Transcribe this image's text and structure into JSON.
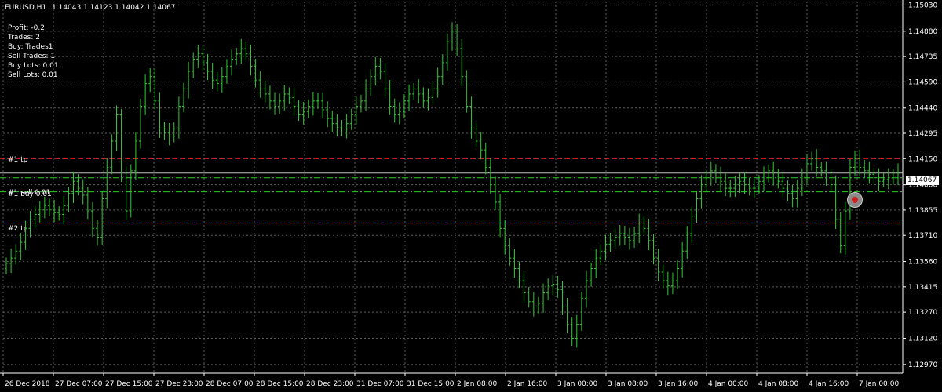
{
  "chart_header": {
    "symbol_timeframe": "EURUSD,H1",
    "ohlc": "1.14043 1.14123 1.14042 1.14067"
  },
  "stats": [
    "Profit: -0.2",
    "Trades: 2",
    "Buy: Trades1",
    "Sell Trades: 1",
    "Buy Lots: 0.01",
    "Sell Lots: 0.01"
  ],
  "colors": {
    "background": "#000000",
    "grid": "#5a5a5a",
    "bars": "#33cc33",
    "tp_line": "#ff2020",
    "entry_line": "#33cc33",
    "bid_line": "#c0c0c0",
    "axis_text": "#ffffff"
  },
  "order_lines": [
    {
      "label": "#1 tp",
      "price": 1.1415,
      "style": "dashed",
      "color": "#ff2020"
    },
    {
      "label": "#1 sell 0.01",
      "price": 1.1404,
      "style": "dash-dot",
      "color": "#33cc33"
    },
    {
      "label": "#1 buy 0.01",
      "price": 1.1396,
      "style": "dash-dot",
      "color": "#33cc33"
    },
    {
      "label": "#2 tp",
      "price": 1.1378,
      "style": "dashed",
      "color": "#ff2020"
    }
  ],
  "current_price": {
    "label": "1.14067",
    "value": 1.14067
  },
  "trade_marker_icon": "trade-arrow-icon",
  "chart_data": {
    "type": "ohlc-bar",
    "title": "EURUSD,H1",
    "ylim": [
      1.1292,
      1.1505
    ],
    "y_ticks": [
      "1.15030",
      "1.14880",
      "1.14735",
      "1.14590",
      "1.14440",
      "1.14295",
      "1.14150",
      "1.14000",
      "1.13855",
      "1.13710",
      "1.13560",
      "1.13415",
      "1.13270",
      "1.13120",
      "1.12970"
    ],
    "x_ticks": [
      "26 Dec 2018",
      "27 Dec 07:00",
      "27 Dec 15:00",
      "27 Dec 23:00",
      "28 Dec 07:00",
      "28 Dec 15:00",
      "28 Dec 23:00",
      "31 Dec 07:00",
      "31 Dec 15:00",
      "2 Jan 08:00",
      "2 Jan 16:00",
      "3 Jan 00:00",
      "3 Jan 08:00",
      "3 Jan 16:00",
      "4 Jan 00:00",
      "4 Jan 08:00",
      "4 Jan 16:00",
      "7 Jan 00:00"
    ],
    "grid": true,
    "close": [
      1.1355,
      1.1358,
      1.1362,
      1.1367,
      1.1375,
      1.138,
      1.1383,
      1.1386,
      1.1388,
      1.1386,
      1.1384,
      1.1383,
      1.1388,
      1.1395,
      1.1402,
      1.1398,
      1.1394,
      1.1385,
      1.1375,
      1.137,
      1.1392,
      1.141,
      1.1425,
      1.144,
      1.1405,
      1.1385,
      1.1408,
      1.1425,
      1.1445,
      1.1458,
      1.1462,
      1.1448,
      1.1432,
      1.143,
      1.1428,
      1.1432,
      1.1445,
      1.1455,
      1.1465,
      1.1472,
      1.1475,
      1.147,
      1.1465,
      1.146,
      1.1458,
      1.1462,
      1.1468,
      1.1472,
      1.1475,
      1.1478,
      1.1475,
      1.1468,
      1.146,
      1.1455,
      1.1452,
      1.1448,
      1.1445,
      1.1448,
      1.1452,
      1.145,
      1.1445,
      1.144,
      1.1442,
      1.1445,
      1.1448,
      1.1448,
      1.1443,
      1.1438,
      1.1435,
      1.1433,
      1.1432,
      1.1435,
      1.144,
      1.1445,
      1.1448,
      1.1455,
      1.1462,
      1.1468,
      1.1465,
      1.1455,
      1.1445,
      1.144,
      1.1442,
      1.1448,
      1.1452,
      1.1455,
      1.1452,
      1.1448,
      1.145,
      1.1455,
      1.1462,
      1.147,
      1.1482,
      1.1488,
      1.1478,
      1.1462,
      1.1445,
      1.1432,
      1.1425,
      1.142,
      1.141,
      1.14,
      1.139,
      1.1375,
      1.1365,
      1.1358,
      1.1352,
      1.1345,
      1.1338,
      1.1333,
      1.133,
      1.1332,
      1.1338,
      1.1342,
      1.1343,
      1.134,
      1.133,
      1.132,
      1.1312,
      1.132,
      1.1335,
      1.1345,
      1.1352,
      1.1358,
      1.1362,
      1.1366,
      1.1368,
      1.137,
      1.1372,
      1.137,
      1.1368,
      1.1372,
      1.1378,
      1.1375,
      1.1368,
      1.1358,
      1.135,
      1.1345,
      1.1342,
      1.1345,
      1.1352,
      1.1362,
      1.1372,
      1.1382,
      1.1392,
      1.14,
      1.1405,
      1.1408,
      1.1405,
      1.1402,
      1.1398,
      1.1398,
      1.14,
      1.1402,
      1.14,
      1.1398,
      1.1398,
      1.1402,
      1.1405,
      1.1408,
      1.1405,
      1.1402,
      1.1398,
      1.1395,
      1.1392,
      1.1398,
      1.1405,
      1.1412,
      1.1415,
      1.141,
      1.1408,
      1.1405,
      1.14,
      1.138,
      1.1365,
      1.1385,
      1.141,
      1.1415,
      1.141,
      1.1408,
      1.1406,
      1.1404,
      1.1402,
      1.1403,
      1.1404,
      1.1405,
      1.1407
    ]
  }
}
